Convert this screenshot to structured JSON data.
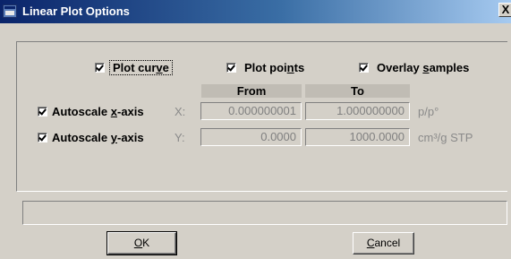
{
  "window": {
    "title": "Linear Plot Options",
    "close_glyph": "X"
  },
  "options": {
    "plot_curve": {
      "label": "Plot curve",
      "checked": true
    },
    "plot_points": {
      "label": "Plot points",
      "checked": true
    },
    "overlay_samples": {
      "label": "Overlay samples",
      "checked": true
    }
  },
  "table": {
    "from_header": "From",
    "to_header": "To"
  },
  "axes": {
    "x": {
      "autoscale_label": "Autoscale x-axis",
      "checked": true,
      "axis_label": "X:",
      "from": "0.000000001",
      "to": "1.000000000",
      "unit": "p/p°"
    },
    "y": {
      "autoscale_label": "Autoscale y-axis",
      "checked": true,
      "axis_label": "Y:",
      "from": "0.0000",
      "to": "1000.0000",
      "unit": "cm³/g STP"
    }
  },
  "status_bar": {
    "text": ""
  },
  "buttons": {
    "ok": "OK",
    "cancel": "Cancel"
  }
}
